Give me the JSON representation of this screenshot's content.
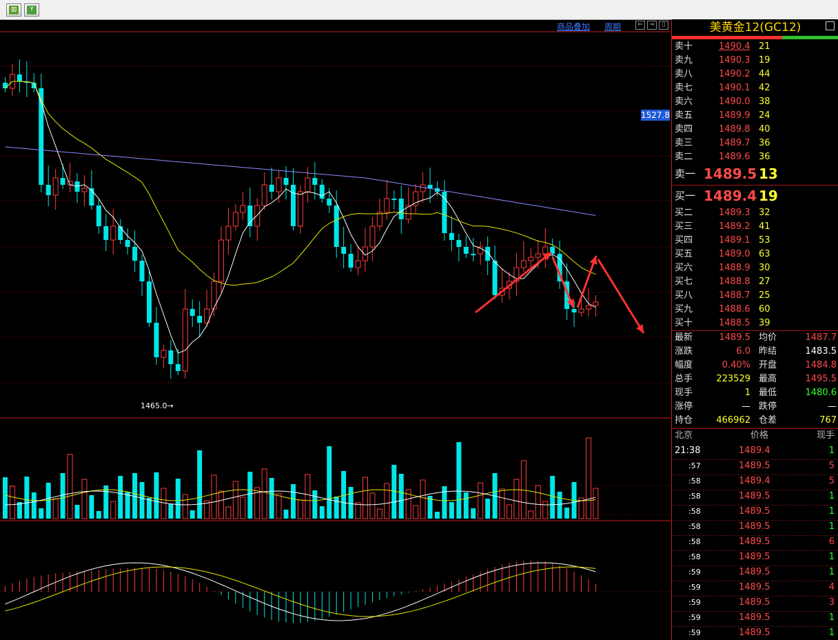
{
  "toolbar": {
    "icons": [
      "chart-icon",
      "filter-icon"
    ]
  },
  "chart_header": {
    "link_overlay": "商品叠加",
    "link_period": "周期"
  },
  "chart": {
    "price_tag": "1527.8",
    "low_label": "1465.0→"
  },
  "panel": {
    "title": "美黄金12(GC12)",
    "asks": [
      {
        "label": "卖十",
        "price": "1490.4",
        "vol": "21"
      },
      {
        "label": "卖九",
        "price": "1490.3",
        "vol": "19"
      },
      {
        "label": "卖八",
        "price": "1490.2",
        "vol": "44"
      },
      {
        "label": "卖七",
        "price": "1490.1",
        "vol": "42"
      },
      {
        "label": "卖六",
        "price": "1490.0",
        "vol": "38"
      },
      {
        "label": "卖五",
        "price": "1489.9",
        "vol": "24"
      },
      {
        "label": "卖四",
        "price": "1489.8",
        "vol": "40"
      },
      {
        "label": "卖三",
        "price": "1489.7",
        "vol": "36"
      },
      {
        "label": "卖二",
        "price": "1489.6",
        "vol": "36"
      }
    ],
    "ask1": {
      "label": "卖一",
      "price": "1489.5",
      "vol": "13"
    },
    "bid1": {
      "label": "买一",
      "price": "1489.4",
      "vol": "19"
    },
    "bids": [
      {
        "label": "买二",
        "price": "1489.3",
        "vol": "32"
      },
      {
        "label": "买三",
        "price": "1489.2",
        "vol": "41"
      },
      {
        "label": "买四",
        "price": "1489.1",
        "vol": "53"
      },
      {
        "label": "买五",
        "price": "1489.0",
        "vol": "63"
      },
      {
        "label": "买六",
        "price": "1488.9",
        "vol": "30"
      },
      {
        "label": "买七",
        "price": "1488.8",
        "vol": "27"
      },
      {
        "label": "买八",
        "price": "1488.7",
        "vol": "25"
      },
      {
        "label": "买九",
        "price": "1488.6",
        "vol": "60"
      },
      {
        "label": "买十",
        "price": "1488.5",
        "vol": "39"
      }
    ],
    "stats": [
      {
        "l1": "最新",
        "v1": "1489.5",
        "l2": "均价",
        "v2": "1487.7"
      },
      {
        "l1": "涨跌",
        "v1": "6.0",
        "l2": "昨结",
        "v2": "1483.5"
      },
      {
        "l1": "幅度",
        "v1": "0.40%",
        "l2": "开盘",
        "v2": "1484.8"
      },
      {
        "l1": "总手",
        "v1": "223529",
        "l2": "最高",
        "v2": "1495.5"
      },
      {
        "l1": "现手",
        "v1": "1",
        "l2": "最低",
        "v2": "1480.6"
      },
      {
        "l1": "涨停",
        "v1": "—",
        "l2": "跌停",
        "v2": "—"
      },
      {
        "l1": "持仓",
        "v1": "466962",
        "l2": "仓差",
        "v2": "767"
      }
    ],
    "ticks_header": {
      "time": "北京",
      "price": "价格",
      "vol": "现手"
    },
    "ticks": [
      {
        "time": "21:38",
        "price": "1489.4",
        "vol": "1"
      },
      {
        "time": ":57",
        "price": "1489.5",
        "vol": "5"
      },
      {
        "time": ":58",
        "price": "1489.4",
        "vol": "5"
      },
      {
        "time": ":58",
        "price": "1489.5",
        "vol": "1"
      },
      {
        "time": ":58",
        "price": "1489.5",
        "vol": "1"
      },
      {
        "time": ":58",
        "price": "1489.5",
        "vol": "1"
      },
      {
        "time": ":58",
        "price": "1489.5",
        "vol": "6"
      },
      {
        "time": ":58",
        "price": "1489.5",
        "vol": "1"
      },
      {
        "time": ":59",
        "price": "1489.5",
        "vol": "1"
      },
      {
        "time": ":59",
        "price": "1489.5",
        "vol": "4"
      },
      {
        "time": ":59",
        "price": "1489.5",
        "vol": "3"
      },
      {
        "time": ":59",
        "price": "1489.5",
        "vol": "1"
      },
      {
        "time": ":59",
        "price": "1489.5",
        "vol": "1"
      }
    ]
  },
  "colors": {
    "up": "#ff3c3c",
    "down": "#00e6e6",
    "ma_fast": "#ffffff",
    "ma_mid": "#e6e600",
    "ma_slow": "#8c8cff",
    "grid": "#8c1414",
    "arrow": "#ff3232"
  }
}
